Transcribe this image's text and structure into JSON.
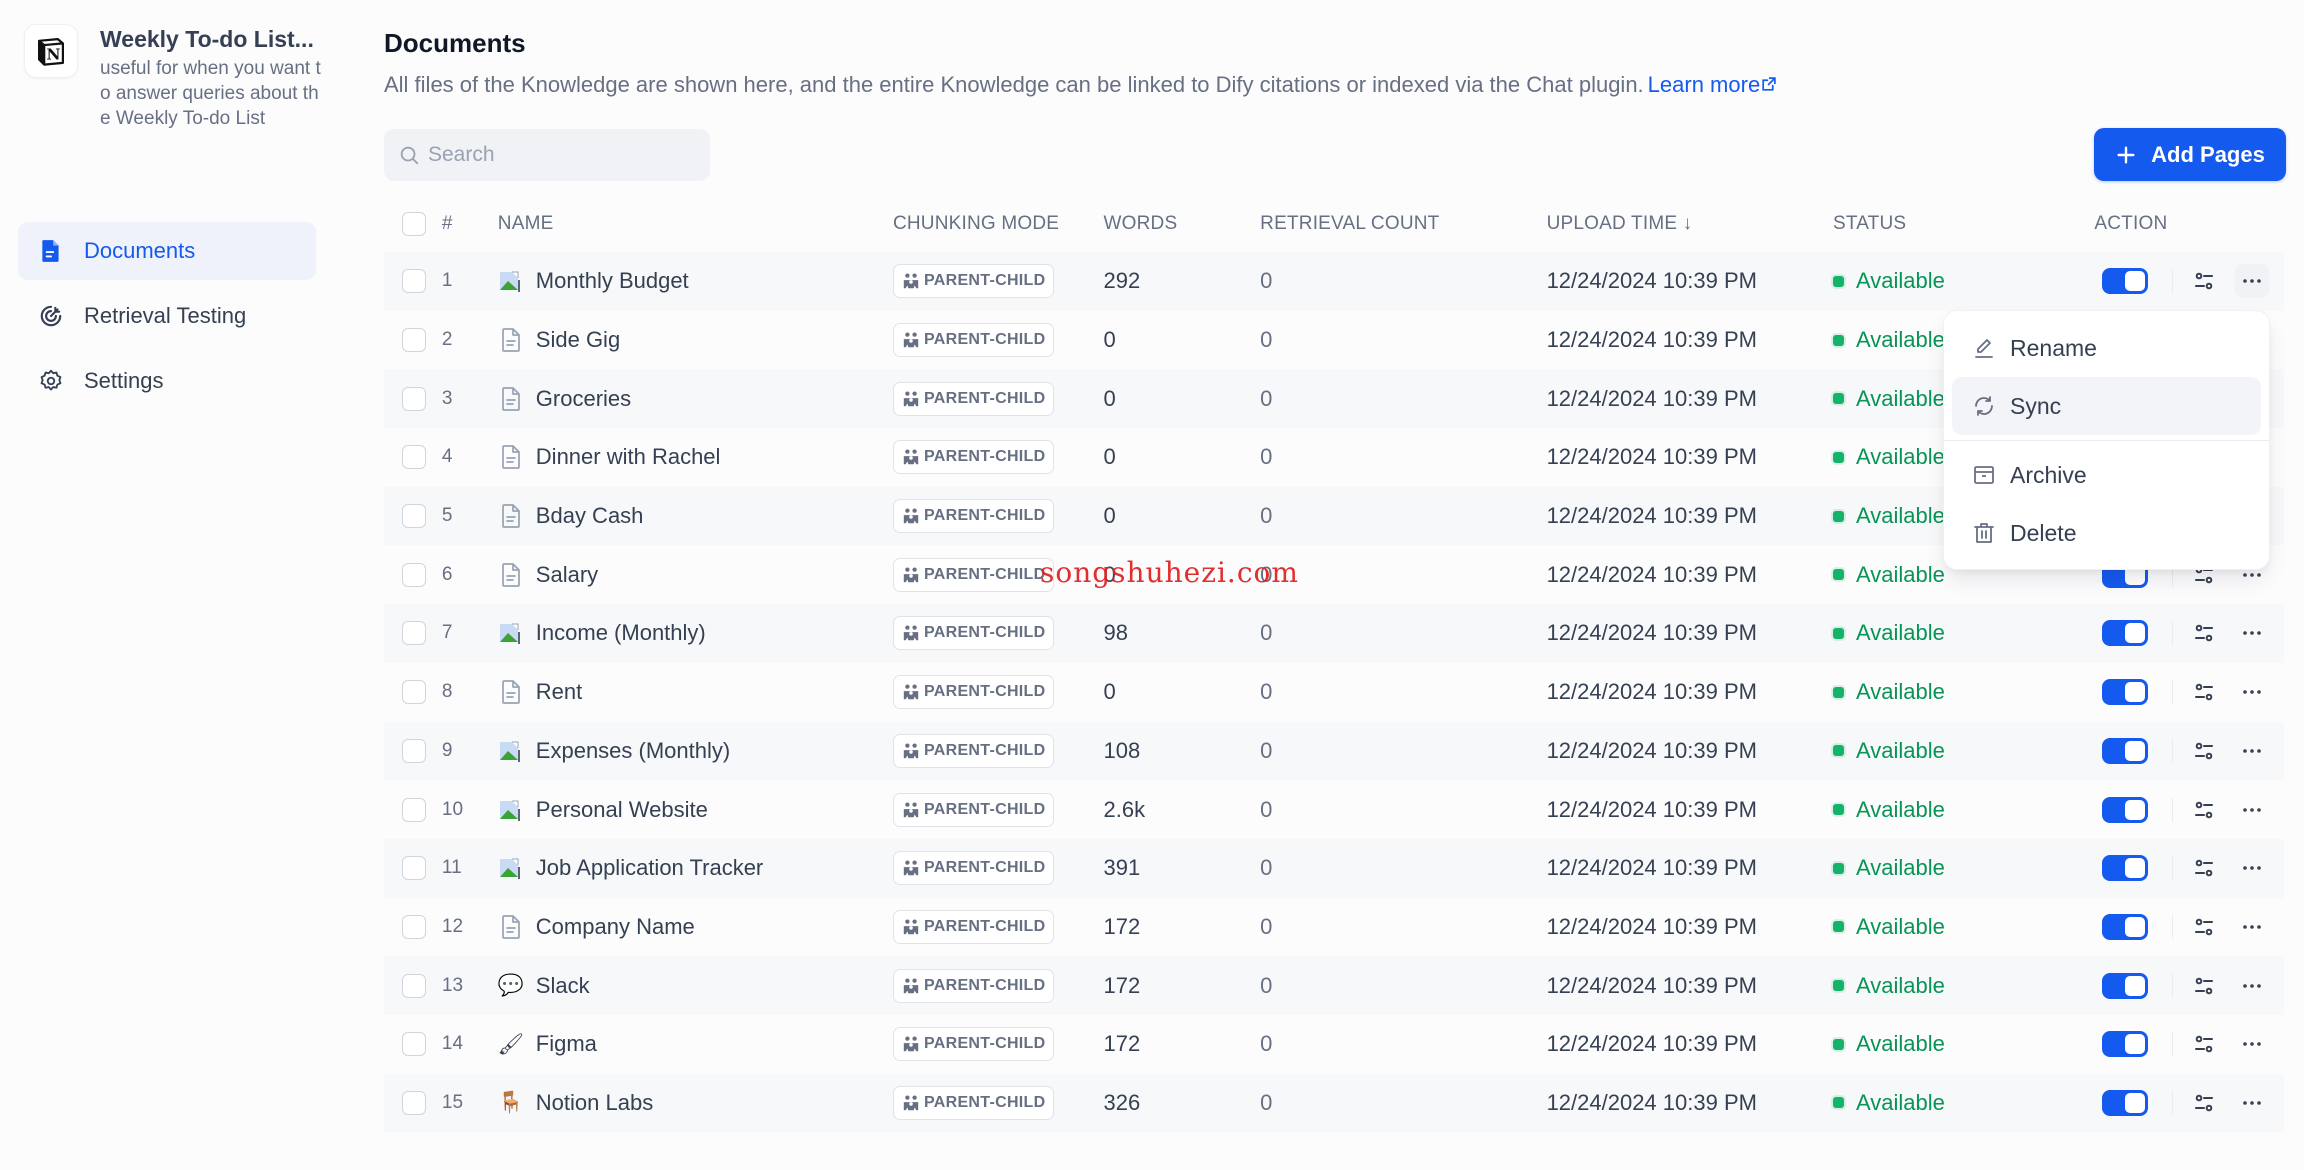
{
  "knowledge": {
    "title": "Weekly To-do List...",
    "description": "useful for when you want to answer queries about the Weekly To-do List",
    "logo_icon": "notion-logo-icon"
  },
  "sidebar": {
    "items": [
      {
        "label": "Documents",
        "icon": "document-icon",
        "active": true
      },
      {
        "label": "Retrieval Testing",
        "icon": "target-icon",
        "active": false
      },
      {
        "label": "Settings",
        "icon": "gear-icon",
        "active": false
      }
    ]
  },
  "header": {
    "title": "Documents",
    "description": "All files of the Knowledge are shown here, and the entire Knowledge can be linked to Dify citations or indexed via the Chat plugin.",
    "learn_more": "Learn more"
  },
  "search": {
    "placeholder": "Search",
    "value": ""
  },
  "add_button": {
    "label": "Add Pages"
  },
  "table": {
    "columns": [
      "#",
      "NAME",
      "CHUNKING MODE",
      "WORDS",
      "RETRIEVAL COUNT",
      "UPLOAD TIME",
      "STATUS",
      "ACTION"
    ],
    "sort_indicator": "↓",
    "rows": [
      {
        "num": "1",
        "icon": "broken-image",
        "name": "Monthly Budget",
        "mode": "PARENT-CHILD",
        "words": "292",
        "retrieval": "0",
        "time": "12/24/2024 10:39 PM",
        "status": "Available",
        "enabled": true
      },
      {
        "num": "2",
        "icon": "file",
        "name": "Side Gig",
        "mode": "PARENT-CHILD",
        "words": "0",
        "retrieval": "0",
        "time": "12/24/2024 10:39 PM",
        "status": "Available",
        "enabled": true
      },
      {
        "num": "3",
        "icon": "file",
        "name": "Groceries",
        "mode": "PARENT-CHILD",
        "words": "0",
        "retrieval": "0",
        "time": "12/24/2024 10:39 PM",
        "status": "Available",
        "enabled": true
      },
      {
        "num": "4",
        "icon": "file",
        "name": "Dinner with Rachel",
        "mode": "PARENT-CHILD",
        "words": "0",
        "retrieval": "0",
        "time": "12/24/2024 10:39 PM",
        "status": "Available",
        "enabled": true
      },
      {
        "num": "5",
        "icon": "file",
        "name": "Bday Cash",
        "mode": "PARENT-CHILD",
        "words": "0",
        "retrieval": "0",
        "time": "12/24/2024 10:39 PM",
        "status": "Available",
        "enabled": true
      },
      {
        "num": "6",
        "icon": "file",
        "name": "Salary",
        "mode": "PARENT-CHILD",
        "words": "0",
        "retrieval": "0",
        "time": "12/24/2024 10:39 PM",
        "status": "Available",
        "enabled": true
      },
      {
        "num": "7",
        "icon": "broken-image",
        "name": "Income (Monthly)",
        "mode": "PARENT-CHILD",
        "words": "98",
        "retrieval": "0",
        "time": "12/24/2024 10:39 PM",
        "status": "Available",
        "enabled": true
      },
      {
        "num": "8",
        "icon": "file",
        "name": "Rent",
        "mode": "PARENT-CHILD",
        "words": "0",
        "retrieval": "0",
        "time": "12/24/2024 10:39 PM",
        "status": "Available",
        "enabled": true
      },
      {
        "num": "9",
        "icon": "broken-image",
        "name": "Expenses (Monthly)",
        "mode": "PARENT-CHILD",
        "words": "108",
        "retrieval": "0",
        "time": "12/24/2024 10:39 PM",
        "status": "Available",
        "enabled": true
      },
      {
        "num": "10",
        "icon": "broken-image",
        "name": "Personal Website",
        "mode": "PARENT-CHILD",
        "words": "2.6k",
        "retrieval": "0",
        "time": "12/24/2024 10:39 PM",
        "status": "Available",
        "enabled": true
      },
      {
        "num": "11",
        "icon": "broken-image",
        "name": "Job Application Tracker",
        "mode": "PARENT-CHILD",
        "words": "391",
        "retrieval": "0",
        "time": "12/24/2024 10:39 PM",
        "status": "Available",
        "enabled": true
      },
      {
        "num": "12",
        "icon": "file",
        "name": "Company Name",
        "mode": "PARENT-CHILD",
        "words": "172",
        "retrieval": "0",
        "time": "12/24/2024 10:39 PM",
        "status": "Available",
        "enabled": true
      },
      {
        "num": "13",
        "icon": "emoji",
        "emoji": "💬",
        "name": "Slack",
        "mode": "PARENT-CHILD",
        "words": "172",
        "retrieval": "0",
        "time": "12/24/2024 10:39 PM",
        "status": "Available",
        "enabled": true
      },
      {
        "num": "14",
        "icon": "emoji",
        "emoji": "🖌",
        "name": "Figma",
        "mode": "PARENT-CHILD",
        "words": "172",
        "retrieval": "0",
        "time": "12/24/2024 10:39 PM",
        "status": "Available",
        "enabled": true
      },
      {
        "num": "15",
        "icon": "emoji",
        "emoji": "🪑",
        "name": "Notion Labs",
        "mode": "PARENT-CHILD",
        "words": "326",
        "retrieval": "0",
        "time": "12/24/2024 10:39 PM",
        "status": "Available",
        "enabled": true
      }
    ]
  },
  "context_menu": {
    "items": [
      {
        "label": "Rename",
        "icon": "edit-icon"
      },
      {
        "label": "Sync",
        "icon": "sync-icon"
      },
      {
        "label": "Archive",
        "icon": "archive-icon"
      },
      {
        "label": "Delete",
        "icon": "trash-icon"
      }
    ]
  },
  "watermark": "songshuhezi.com",
  "colors": {
    "accent": "#155aef",
    "status_available": "#079455",
    "status_dot": "#17b26a"
  }
}
